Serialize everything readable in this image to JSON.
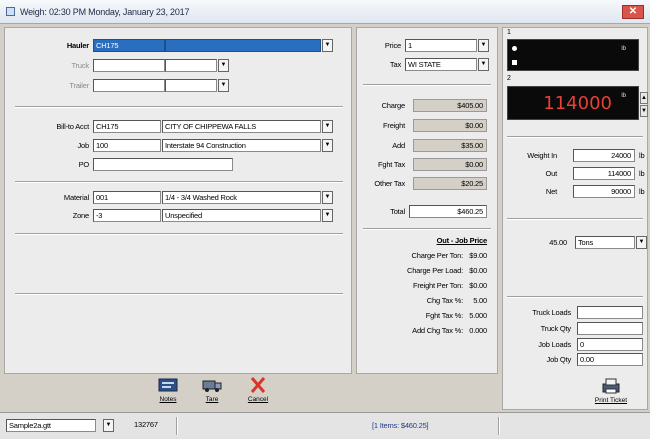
{
  "window": {
    "title": "Weigh: 02:30 PM  Monday, January 23, 2017",
    "close_label": "✕"
  },
  "form": {
    "hauler": {
      "label": "Hauler",
      "value": "CH175",
      "name": ""
    },
    "truck": {
      "label": "Truck",
      "value": "",
      "name": ""
    },
    "trailer": {
      "label": "Trailer",
      "value": "",
      "name": ""
    },
    "bill_to": {
      "label": "Bill-to Acct",
      "value": "CH175",
      "name": "CITY OF CHIPPEWA FALLS"
    },
    "job": {
      "label": "Job",
      "value": "100",
      "name": "Interstate 94 Construction"
    },
    "po": {
      "label": "PO",
      "value": ""
    },
    "material": {
      "label": "Material",
      "value": "001",
      "name": "1/4 - 3/4 Washed Rock"
    },
    "zone": {
      "label": "Zone",
      "value": "-3",
      "name": "Unspecified"
    }
  },
  "pricing": {
    "price": {
      "label": "Price",
      "value": "1"
    },
    "tax": {
      "label": "Tax",
      "value": "WI STATE"
    },
    "rows": [
      {
        "label": "Charge",
        "value": "$405.00"
      },
      {
        "label": "Freight",
        "value": "$0.00"
      },
      {
        "label": "Add",
        "value": "$35.00"
      },
      {
        "label": "Fght Tax",
        "value": "$0.00"
      },
      {
        "label": "Other Tax",
        "value": "$20.25"
      }
    ],
    "total": {
      "label": "Total",
      "value": "$460.25"
    },
    "job_price_heading": "Out - Job Price",
    "job_price_rows": [
      {
        "label": "Charge Per Ton:",
        "value": "$9.00"
      },
      {
        "label": "Charge Per Load:",
        "value": "$0.00"
      },
      {
        "label": "Freight Per Ton:",
        "value": "$0.00"
      },
      {
        "label": "Chg Tax %:",
        "value": "5.00"
      },
      {
        "label": "Fght Tax %:",
        "value": "5.000"
      },
      {
        "label": "Add Chg Tax %:",
        "value": "0.000"
      }
    ]
  },
  "scales": {
    "scale1": {
      "label": "1",
      "value": "",
      "unit": "lb"
    },
    "scale2": {
      "label": "2",
      "value": "114000",
      "unit": "lb"
    }
  },
  "weights": {
    "rows": [
      {
        "label": "Weight In",
        "value": "24000",
        "unit": "lb"
      },
      {
        "label": "Out",
        "value": "114000",
        "unit": "lb"
      },
      {
        "label": "Net",
        "value": "90000",
        "unit": "lb"
      }
    ],
    "qty_value": "45.00",
    "qty_unit": "Tons"
  },
  "loads": {
    "rows": [
      {
        "label": "Truck Loads",
        "value": ""
      },
      {
        "label": "Truck Qty",
        "value": ""
      },
      {
        "label": "Job Loads",
        "value": "0"
      },
      {
        "label": "Job Qty",
        "value": "0.00"
      }
    ]
  },
  "toolbar": {
    "notes": "Notes",
    "tare": "Tare",
    "cancel": "Cancel",
    "print": "Print Ticket"
  },
  "status": {
    "file": "Sample2a.gtt",
    "number": "132767",
    "summary": "[1 Items: $460.25]"
  },
  "colors": {
    "selection": "#2a6fbf",
    "scale_digits": "#e84034",
    "scale_background": "#0a0a0a",
    "cancel_icon": "#d9342a"
  }
}
